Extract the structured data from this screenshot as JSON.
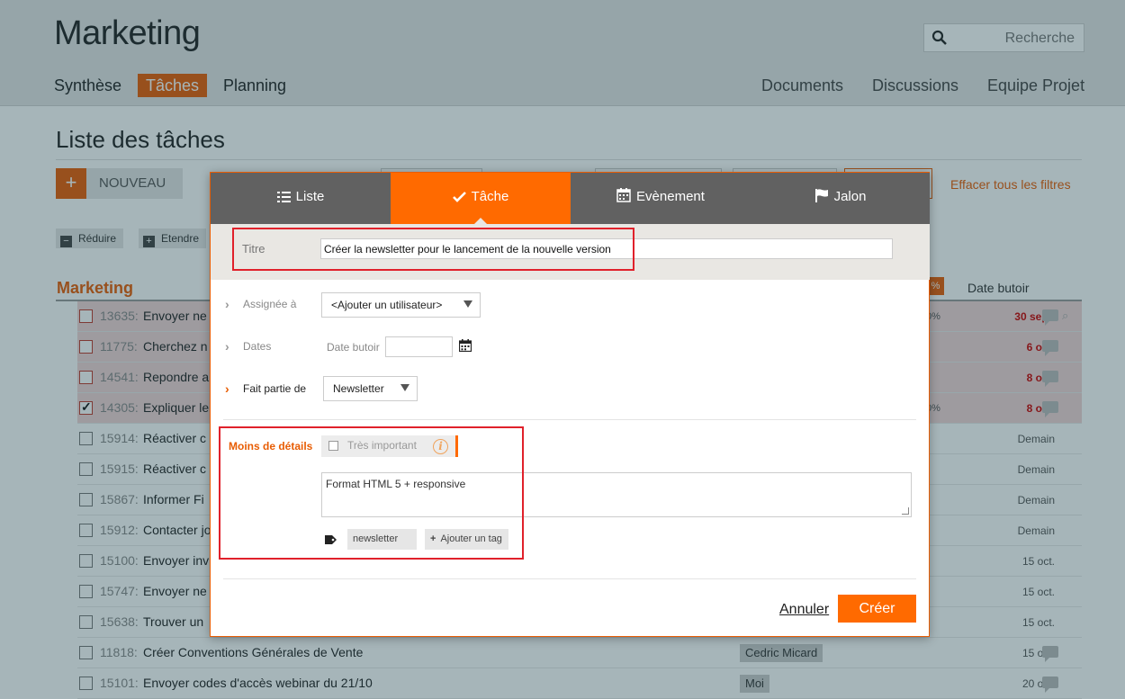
{
  "app": {
    "title": "Marketing",
    "search_placeholder": "Recherche",
    "nav_left": [
      "Synthèse",
      "Tâches",
      "Planning"
    ],
    "nav_right": [
      "Documents",
      "Discussions",
      "Equipe Projet"
    ],
    "active_nav": "Tâches",
    "accent_color": "#e85d04"
  },
  "list": {
    "title": "Liste des tâches",
    "new_button": "NOUVEAU",
    "clear_filters": "Effacer tous les filtres",
    "reduce_button": "Réduire",
    "expand_button": "Etendre",
    "group_name": "Marketing",
    "col_due": "Date butoir",
    "rows": [
      {
        "id": "13635",
        "text": "Envoyer ne",
        "date": "30 sept.",
        "late": true,
        "checked": false,
        "pct": "0%"
      },
      {
        "id": "11775",
        "text": "Cherchez n",
        "date": "6 oct.",
        "late": true,
        "checked": false
      },
      {
        "id": "14541",
        "text": "Repondre a",
        "date": "8 oct.",
        "late": true,
        "checked": false
      },
      {
        "id": "14305",
        "text": "Expliquer le",
        "date": "8 oct.",
        "late": true,
        "checked": true,
        "pct": "0%"
      },
      {
        "id": "15914",
        "text": "Réactiver c",
        "date": "Demain",
        "late": false,
        "checked": false
      },
      {
        "id": "15915",
        "text": "Réactiver c",
        "date": "Demain",
        "late": false,
        "checked": false
      },
      {
        "id": "15867",
        "text": "Informer Fi",
        "date": "Demain",
        "late": false,
        "checked": false
      },
      {
        "id": "15912",
        "text": "Contacter jo",
        "date": "Demain",
        "late": false,
        "checked": false
      },
      {
        "id": "15100",
        "text": "Envoyer inv",
        "date": "15 oct.",
        "late": false,
        "checked": false
      },
      {
        "id": "15747",
        "text": "Envoyer ne",
        "date": "15 oct.",
        "late": false,
        "checked": false
      },
      {
        "id": "15638",
        "text": "Trouver un",
        "date": "15 oct.",
        "late": false,
        "checked": false
      },
      {
        "id": "11818",
        "text": "Créer Conventions Générales de Vente",
        "date": "15 oct.",
        "late": false,
        "checked": false,
        "assignee": "Cedric Micard"
      },
      {
        "id": "15101",
        "text": "Envoyer codes d'accès webinar du 21/10",
        "date": "20 oct.",
        "late": false,
        "checked": false,
        "assignee": "Moi"
      }
    ]
  },
  "modal": {
    "tabs": [
      {
        "label": "Liste",
        "icon": "list-icon"
      },
      {
        "label": "Tâche",
        "icon": "check-icon"
      },
      {
        "label": "Evènement",
        "icon": "calendar-icon"
      },
      {
        "label": "Jalon",
        "icon": "flag-icon"
      }
    ],
    "active_tab": "Tâche",
    "title_label": "Titre",
    "title_value": "Créer la newsletter pour le lancement de la nouvelle version",
    "assigned_label": "Assignée à",
    "assigned_value": "<Ajouter un utilisateur>",
    "dates_label": "Dates",
    "due_label": "Date butoir",
    "due_value": "",
    "part_of_label": "Fait partie de",
    "part_of_value": "Newsletter",
    "less_details": "Moins de détails",
    "important_label": "Très important",
    "notes_value": "Format HTML 5 + responsive",
    "tag": "newsletter",
    "add_tag": "Ajouter un tag",
    "cancel": "Annuler",
    "create": "Créer"
  }
}
